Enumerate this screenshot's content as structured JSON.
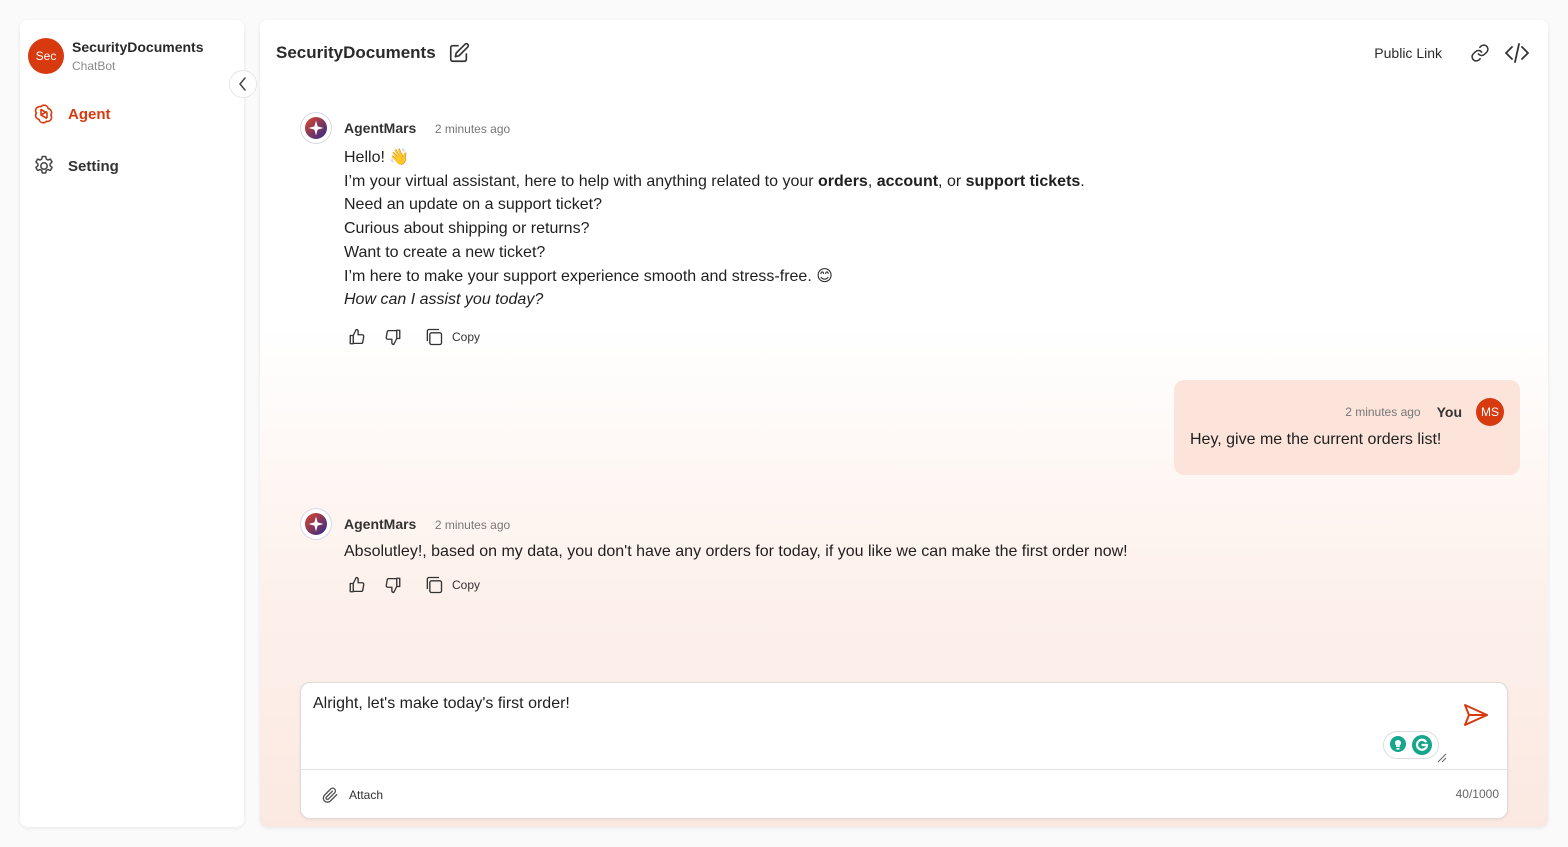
{
  "sidebar": {
    "bot_avatar": "Sec",
    "bot_name": "SecurityDocuments",
    "bot_type": "ChatBot",
    "nav": [
      {
        "label": "Agent",
        "icon": "openai-icon",
        "active": true
      },
      {
        "label": "Setting",
        "icon": "gear-icon",
        "active": false
      }
    ]
  },
  "header": {
    "title": "SecurityDocuments",
    "public_link": "Public Link"
  },
  "messages": [
    {
      "sender": "AgentMars",
      "time": "2 minutes ago",
      "lines": {
        "l1": "Hello! 👋",
        "l2_pre": "I’m your virtual assistant, here to help with anything related to your ",
        "l2_b1": "orders",
        "l2_s1": ", ",
        "l2_b2": "account",
        "l2_s2": ", or ",
        "l2_b3": "support tickets",
        "l2_end": ".",
        "l3": "Need an update on a support ticket?",
        "l4": "Curious about shipping or returns?",
        "l5": "Want to create a new ticket?",
        "l6": "I’m here to make your support experience smooth and stress-free. 😊",
        "l7": "How can I assist you today?"
      },
      "copy_label": "Copy"
    },
    {
      "sender": "You",
      "avatar": "MS",
      "time": "2 minutes ago",
      "text": "Hey, give me the current orders list!"
    },
    {
      "sender": "AgentMars",
      "time": "2 minutes ago",
      "text": "Absolutley!, based on my data, you don't have any orders for today, if you like we can make the first order now!",
      "copy_label": "Copy"
    }
  ],
  "composer": {
    "value": "Alright, let's make today's first order!",
    "attach_label": "Attach",
    "counter": "40/1000"
  },
  "colors": {
    "accent": "#d83a0f",
    "user_bubble": "#fce4da"
  }
}
